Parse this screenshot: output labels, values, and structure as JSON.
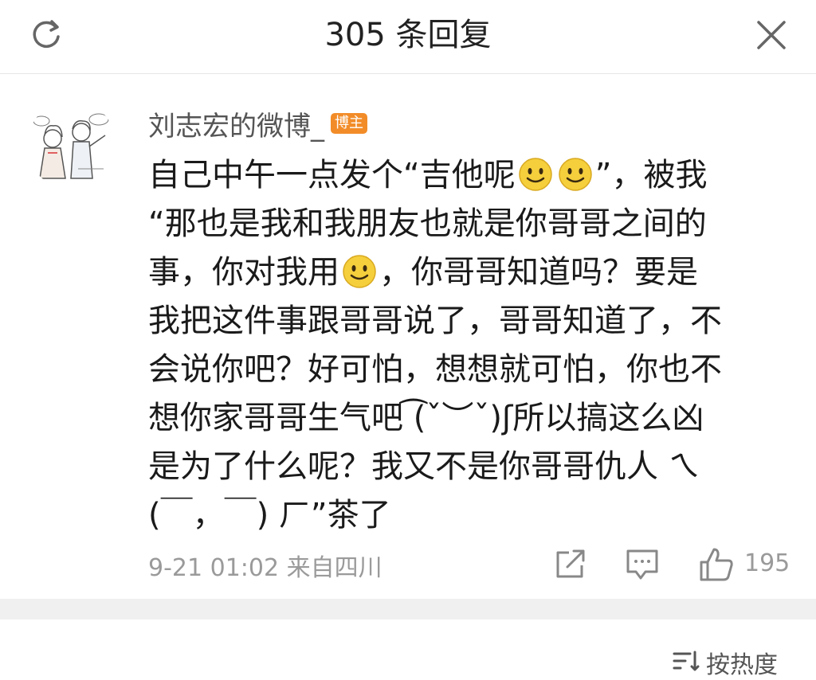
{
  "header": {
    "title": "305 条回复",
    "refresh_icon": "refresh-icon",
    "close_icon": "close-icon"
  },
  "comment": {
    "avatar": "avatar-illustration",
    "username": "刘志宏的微博_",
    "badge": "博主",
    "content_lines": [
      [
        "自己中午一点发个“吉他呢",
        "[smile]",
        "[smile]",
        "”，被我"
      ],
      [
        "“那也是我和我朋友也就是你哥哥之间的"
      ],
      [
        "事，你对我用",
        "[smile]",
        "，你哥哥知道吗？要是"
      ],
      [
        "我把这件事跟哥哥说了，哥哥知道了，不"
      ],
      [
        "会说你吧？好可怕，想想就可怕，你也不"
      ],
      [
        "想你家哥哥生气吧 ͡(ˇ︶ˇ)ʃ所以搞这么凶"
      ],
      [
        "是为了什么呢？我又不是你哥哥仇人 ㄟ"
      ],
      [
        "(￣，￣) ㄏ”茶了"
      ]
    ],
    "meta": "9-21 01:02  来自四川",
    "actions": {
      "share_icon": "share-icon",
      "comment_icon": "comment-icon",
      "like_icon": "thumbs-up-icon",
      "like_count": "195"
    }
  },
  "sort": {
    "label": "按热度",
    "icon": "sort-icon"
  },
  "colors": {
    "badge": "#f28c28",
    "meta": "#9a9a9a",
    "divider": "#f0f0f0",
    "smiley": "#f5cf3c"
  }
}
